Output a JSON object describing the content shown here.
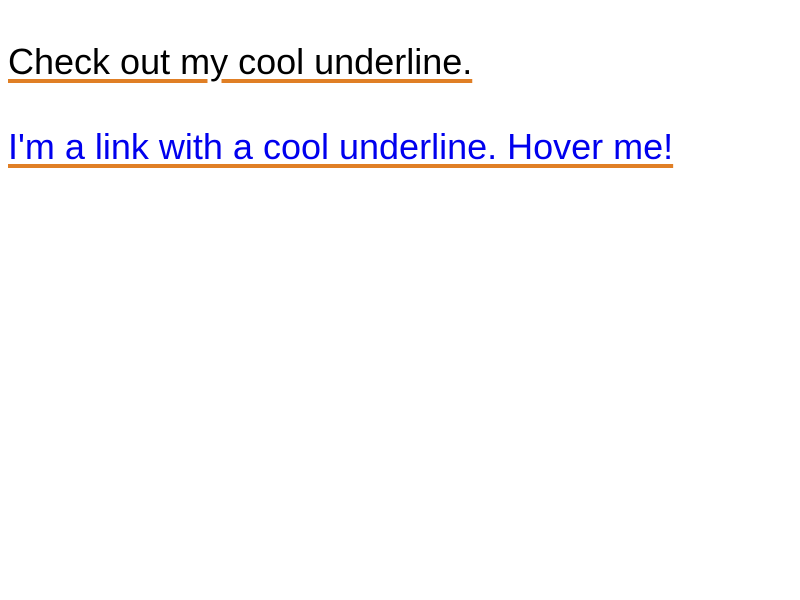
{
  "colors": {
    "underline": "#e07f25",
    "text": "#000000",
    "link": "#0000ee",
    "background": "#ffffff"
  },
  "content": {
    "underlined_text": "Check out my cool underline.",
    "underlined_link": "I'm a link with a cool underline. Hover me!"
  }
}
